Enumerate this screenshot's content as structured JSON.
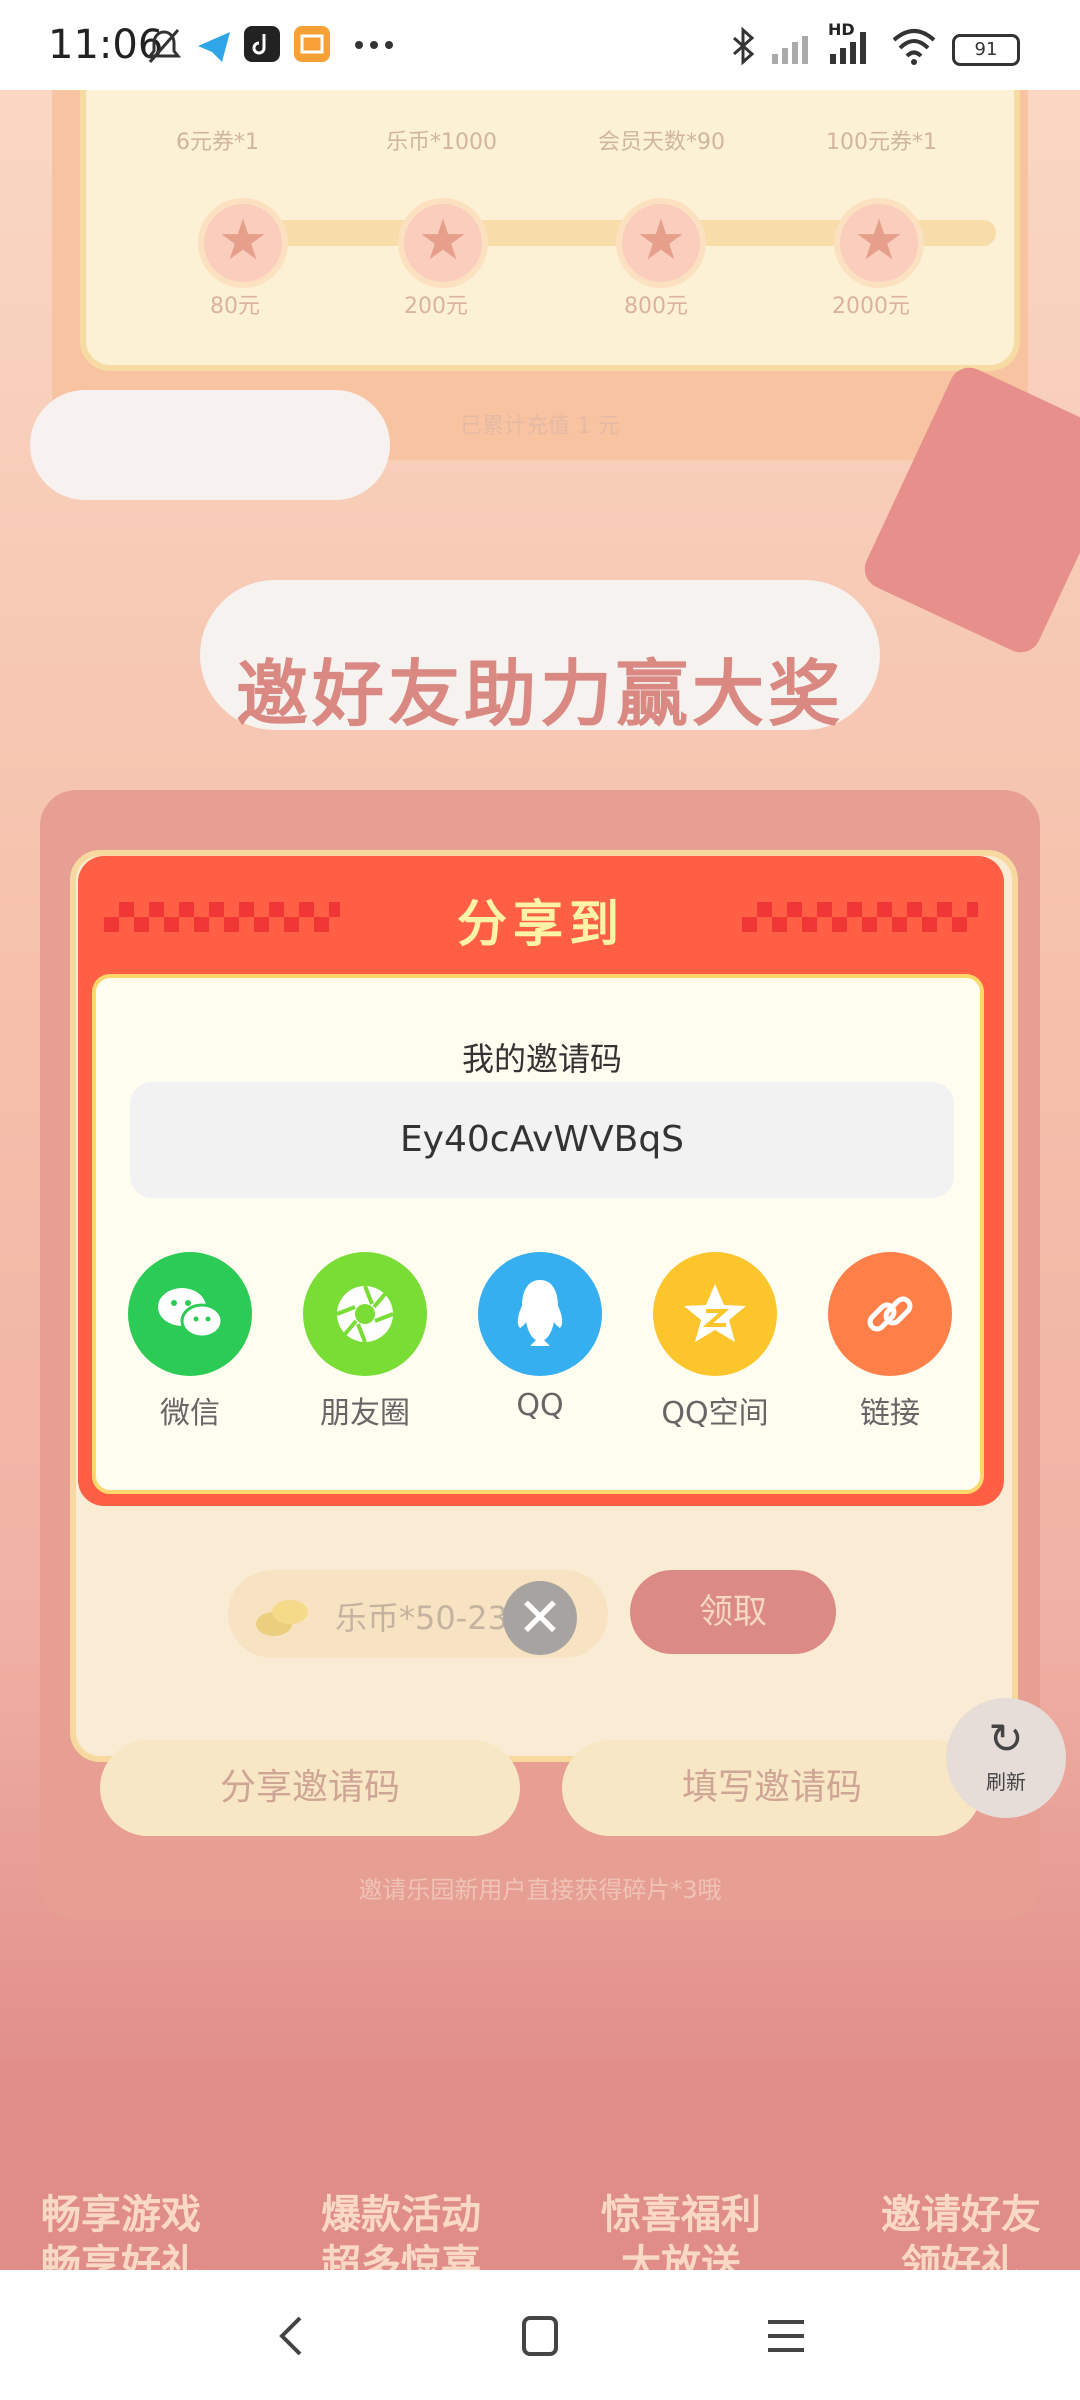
{
  "status_bar": {
    "time": "11:06",
    "battery": "91",
    "network_label": "HD",
    "icons": [
      "mute-bell-icon",
      "telegram-icon",
      "tiktok-icon",
      "app-icon",
      "more-icon",
      "bluetooth-icon",
      "signal-icon",
      "signal-icon",
      "wifi-icon",
      "battery-icon"
    ]
  },
  "background": {
    "rewards": [
      "6元券*1",
      "乐币*1000",
      "会员天数*90",
      "100元券*1"
    ],
    "milestones": [
      "80元",
      "200元",
      "800元",
      "2000元"
    ],
    "recharge_total": "已累计充值 1 元",
    "section_title": "邀好友助力赢大奖",
    "coin_text": "乐币*50-233",
    "claim_button": "领取",
    "share_code_button": "分享邀请码",
    "fill_code_button": "填写邀请码",
    "footnote": "邀请乐园新用户直接获得碎片*3哦",
    "refresh_label": "刷新",
    "features": [
      {
        "line1": "畅享游戏",
        "line2": "畅享好礼"
      },
      {
        "line1": "爆款活动",
        "line2": "超多惊喜"
      },
      {
        "line1": "惊喜福利",
        "line2": "大放送"
      },
      {
        "line1": "邀请好友",
        "line2": "领好礼"
      }
    ]
  },
  "modal": {
    "title": "分享到",
    "code_label": "我的邀请码",
    "invite_code": "Ey40cAvWVBqS",
    "share_targets": [
      {
        "label": "微信",
        "icon": "wechat-icon",
        "color": "#2ccb56"
      },
      {
        "label": "朋友圈",
        "icon": "moments-icon",
        "color": "#79dd35"
      },
      {
        "label": "QQ",
        "icon": "qq-icon",
        "color": "#35aff0"
      },
      {
        "label": "QQ空间",
        "icon": "qzone-icon",
        "color": "#fdc52c"
      },
      {
        "label": "链接",
        "icon": "link-icon",
        "color": "#fe7f48"
      }
    ]
  },
  "nav": {
    "icons": [
      "back-icon",
      "home-icon",
      "menu-icon"
    ]
  }
}
